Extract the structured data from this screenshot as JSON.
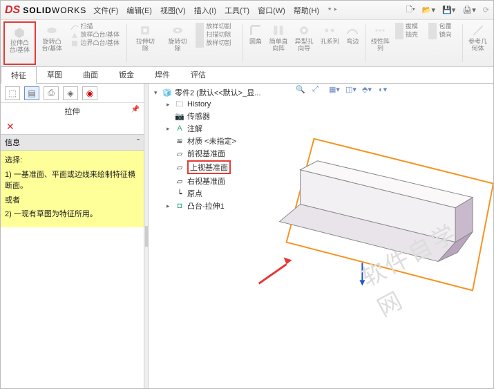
{
  "app": {
    "brand_ds": "DS",
    "brand_solid": "SOLID",
    "brand_works": "WORKS"
  },
  "menu": [
    "文件(F)",
    "编辑(E)",
    "视图(V)",
    "插入(I)",
    "工具(T)",
    "窗口(W)",
    "帮助(H)"
  ],
  "ribbon": {
    "extrude": {
      "l1": "拉伸凸",
      "l2": "台/基体"
    },
    "revolve": {
      "l1": "旋转凸",
      "l2": "台/基体"
    },
    "sweep": "扫描",
    "loft": "放样凸台/基体",
    "boundary": "边界凸台/基体",
    "cut_extrude": {
      "l1": "拉伸切",
      "l2": "除"
    },
    "cut_revolve": {
      "l1": "旋转切",
      "l2": "除"
    },
    "cut_loft": "放样切割",
    "cut_sweep": "扫描切除",
    "cut_boundary": "放样切割",
    "fillet": "圆角",
    "rib_l1": "简单直",
    "rib_l2": "向阵",
    "hole_l1": "异型孔",
    "hole_l2": "向导",
    "pattern": "孔系列",
    "curve": "弯边",
    "linear_l1": "线性阵",
    "linear_l2": "列",
    "draft": "拔模",
    "wrap": "包覆",
    "shell": "抽壳",
    "mirror": "镜向",
    "refgeo_l1": "参考几",
    "refgeo_l2": "何体"
  },
  "tabs": [
    "特征",
    "草图",
    "曲面",
    "钣金",
    "焊件",
    "评估"
  ],
  "pm": {
    "title": "拉伸",
    "info_header": "信息",
    "sel_label": "选择:",
    "line1": "1) 一基准面、平面或边线来绘制特征横断面。",
    "or": "或者",
    "line2": "2) 一现有草图为特征所用。"
  },
  "tree": {
    "root": "零件2 (默认<<默认>_显...",
    "history": "History",
    "sensors": "传感器",
    "annotations": "注解",
    "material": "材质 <未指定>",
    "front": "前视基准面",
    "top": "上视基准面",
    "right": "右视基准面",
    "origin": "原点",
    "boss": "凸台-拉伸1"
  },
  "watermark": "软件自学网"
}
